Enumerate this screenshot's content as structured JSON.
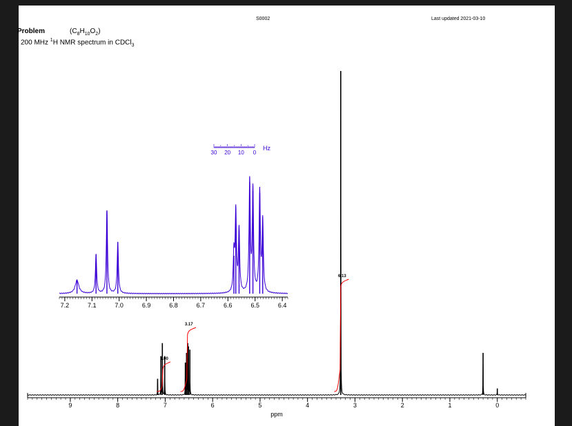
{
  "header": {
    "sample_code": "S0002",
    "last_updated": "Last updated 2021-03-10",
    "problem_label": "Problem",
    "formula": "(C8H10O2)",
    "formula_parts": [
      "(C",
      "8",
      "H",
      "10",
      "O",
      "2",
      ")"
    ],
    "description": "200 MHz 1H NMR spectrum in CDCl3",
    "description_parts": [
      "200 MHz ",
      "1",
      "H NMR spectrum in CDCl",
      "3"
    ]
  },
  "colors": {
    "spectrum": "#000000",
    "integral": "#ff0000",
    "inset": "#3a00d6",
    "page": "#ffffff",
    "background": "#1b1b1b"
  },
  "chart_data": [
    {
      "type": "line",
      "xlabel": "ppm",
      "xlim": [
        9.9,
        -0.6
      ],
      "x_ticks": [
        9,
        8,
        7,
        6,
        5,
        4,
        3,
        2,
        1,
        0
      ],
      "x_tick_labels": [
        "9",
        "8",
        "7",
        "6",
        "5",
        "4",
        "3",
        "2",
        "1",
        "0"
      ],
      "peaks": [
        {
          "ppm": 7.16,
          "height": 0.05
        },
        {
          "ppm": 7.09,
          "height": 0.12
        },
        {
          "ppm": 7.06,
          "height": 0.16
        },
        {
          "ppm": 7.01,
          "height": 0.12
        },
        {
          "ppm": 6.575,
          "height": 0.1
        },
        {
          "ppm": 6.55,
          "height": 0.13
        },
        {
          "ppm": 6.525,
          "height": 0.16
        },
        {
          "ppm": 6.51,
          "height": 0.15
        },
        {
          "ppm": 6.48,
          "height": 0.14
        },
        {
          "ppm": 3.3,
          "height": 1.0
        },
        {
          "ppm": 0.3,
          "height": 0.13
        },
        {
          "ppm": 0.0,
          "height": 0.02
        }
      ],
      "integrals": [
        {
          "label": "1.00",
          "from": 7.12,
          "to": 6.98
        },
        {
          "label": "3.17",
          "from": 6.62,
          "to": 6.44
        },
        {
          "label": "6.13",
          "from": 3.38,
          "to": 3.22
        }
      ],
      "grid": false
    },
    {
      "type": "line",
      "title": "",
      "xlim": [
        7.22,
        6.38
      ],
      "x_ticks": [
        7.2,
        7.1,
        7.0,
        6.9,
        6.8,
        6.7,
        6.6,
        6.5,
        6.4
      ],
      "x_tick_labels": [
        "7.2",
        "7.1",
        "7.0",
        "6.9",
        "6.8",
        "6.7",
        "6.6",
        "6.5",
        "6.4"
      ],
      "hz_scale": {
        "ticks": [
          30,
          20,
          10,
          0
        ],
        "tick_labels": [
          "30",
          "20",
          "10",
          "0"
        ],
        "unit": "Hz"
      },
      "peaks": [
        {
          "ppm": 7.155,
          "height": 0.12
        },
        {
          "ppm": 7.085,
          "height": 0.35
        },
        {
          "ppm": 7.045,
          "height": 0.74
        },
        {
          "ppm": 7.005,
          "height": 0.46
        },
        {
          "ppm": 6.578,
          "height": 0.34
        },
        {
          "ppm": 6.571,
          "height": 0.72
        },
        {
          "ppm": 6.559,
          "height": 0.56
        },
        {
          "ppm": 6.52,
          "height": 1.0
        },
        {
          "ppm": 6.508,
          "height": 0.92
        },
        {
          "ppm": 6.483,
          "height": 0.9
        },
        {
          "ppm": 6.472,
          "height": 0.64
        }
      ],
      "grid": false
    }
  ]
}
